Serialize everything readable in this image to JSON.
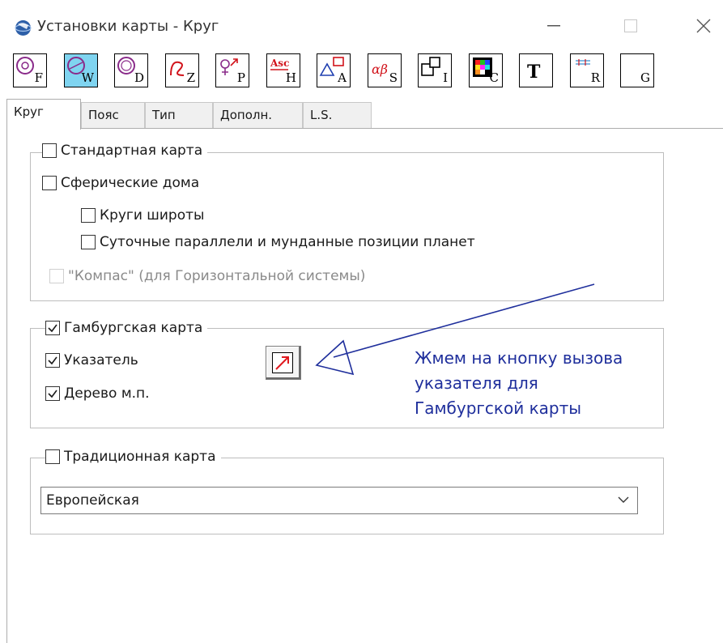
{
  "window": {
    "title": "Установки карты - Круг",
    "icons": {
      "app": "globe-icon",
      "minimize": "minimize-icon",
      "maximize": "maximize-icon",
      "close": "close-icon"
    }
  },
  "toolbar": {
    "buttons": [
      {
        "name": "chart-f-button",
        "sub": "F",
        "active": false
      },
      {
        "name": "chart-w-button",
        "sub": "W",
        "active": true
      },
      {
        "name": "chart-d-button",
        "sub": "D",
        "active": false
      },
      {
        "name": "zodiac-z-button",
        "sub": "Z",
        "active": false
      },
      {
        "name": "planets-p-button",
        "sub": "P",
        "active": false
      },
      {
        "name": "houses-h-button",
        "sub": "H",
        "top": "Asc",
        "active": false
      },
      {
        "name": "aspects-a-button",
        "sub": "A",
        "active": false
      },
      {
        "name": "stars-s-button",
        "sub": "S",
        "top": "αβ",
        "active": false
      },
      {
        "name": "info-i-button",
        "sub": "I",
        "active": false
      },
      {
        "name": "colors-c-button",
        "sub": "C",
        "active": false
      },
      {
        "name": "fonts-t-button",
        "sub": "",
        "top": "T",
        "active": false
      },
      {
        "name": "r-button",
        "sub": "R",
        "active": false
      },
      {
        "name": "g-button",
        "sub": "G",
        "active": false
      }
    ]
  },
  "tabs": [
    {
      "label": "Круг",
      "selected": true
    },
    {
      "label": "Пояс",
      "selected": false
    },
    {
      "label": "Тип",
      "selected": false
    },
    {
      "label": "Дополн.",
      "selected": false
    },
    {
      "label": "L.S.",
      "selected": false
    }
  ],
  "standard_group": {
    "title": "Стандартная карта",
    "title_checked": false,
    "spherical_houses": {
      "label": "Сферические дома",
      "checked": false
    },
    "latitude_circles": {
      "label": "Круги широты",
      "checked": false
    },
    "diurnal_parallels": {
      "label": "Суточные параллели и мунданные позиции планет",
      "checked": false
    },
    "compass": {
      "label": "\"Компас\" (для Горизонтальной системы)",
      "checked": false,
      "disabled": true
    }
  },
  "hamburg_group": {
    "title": "Гамбургская карта",
    "title_checked": true,
    "pointer": {
      "label": "Указатель",
      "checked": true
    },
    "tree": {
      "label": "Дерево м.п.",
      "checked": true
    },
    "pointer_button_icon": "diagonal-arrow-icon"
  },
  "annotation": {
    "lines": [
      "Жмем на кнопку вызова",
      "указателя для",
      "Гамбургской карты"
    ],
    "color": "#1f2f9c"
  },
  "traditional_group": {
    "title": "Традиционная карта",
    "title_checked": false,
    "select_value": "Европейская"
  }
}
